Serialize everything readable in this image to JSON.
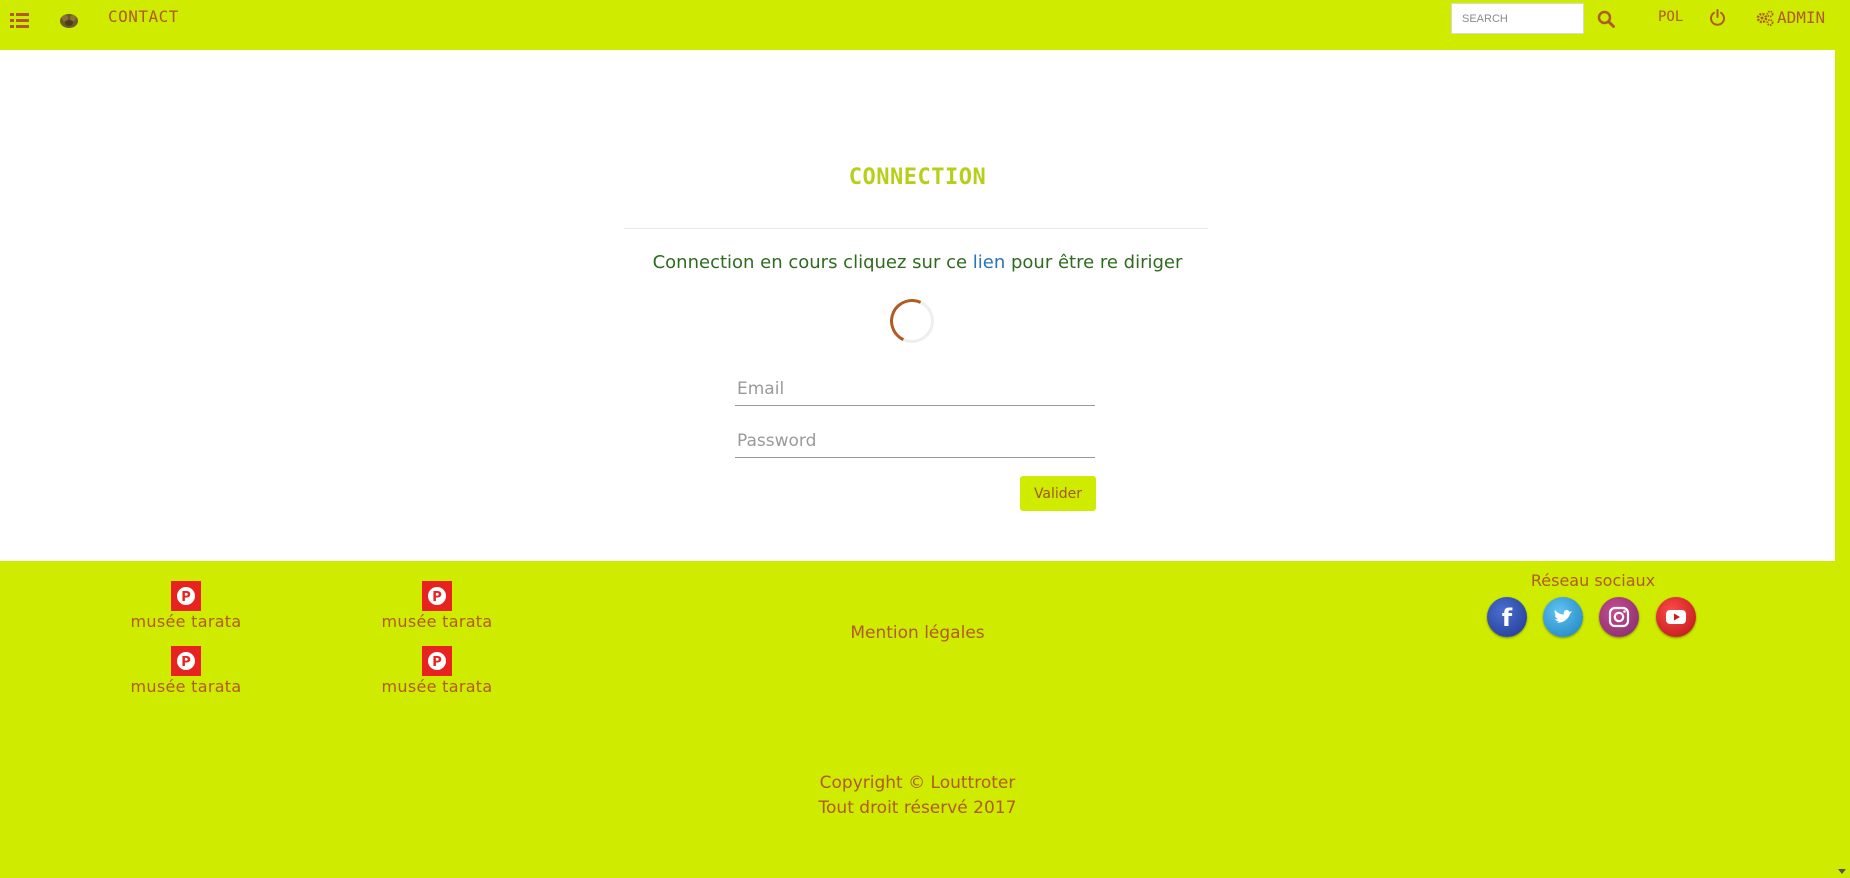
{
  "header": {
    "contact_label": "CONTACT",
    "search_placeholder": "SEARCH",
    "lang_label": "POL",
    "admin_label": "ADMIN"
  },
  "main": {
    "title": "CONNECTION",
    "redirect_prefix": "Connection en cours cliquez sur ce ",
    "redirect_link": "lien",
    "redirect_suffix": " pour être re diriger",
    "email_placeholder": "Email",
    "password_placeholder": "Password",
    "submit_label": "Valider"
  },
  "footer": {
    "pin_items": [
      {
        "label": "musée tarata"
      },
      {
        "label": "musée tarata"
      },
      {
        "label": "musée tarata"
      },
      {
        "label": "musée tarata"
      }
    ],
    "legal_label": "Mention légales",
    "social_title": "Réseau sociaux",
    "social_links": [
      "facebook-icon",
      "twitter-icon",
      "instagram-icon",
      "youtube-icon"
    ],
    "copyright_line1": "Copyright © Louttroter",
    "copyright_line2": "Tout droit réservé 2017"
  },
  "colors": {
    "accent": "#cfeb00",
    "brand_text": "#b05a24",
    "message_text": "#2e6b1f",
    "link": "#2a73b8",
    "pinterest": "#e8231f"
  }
}
